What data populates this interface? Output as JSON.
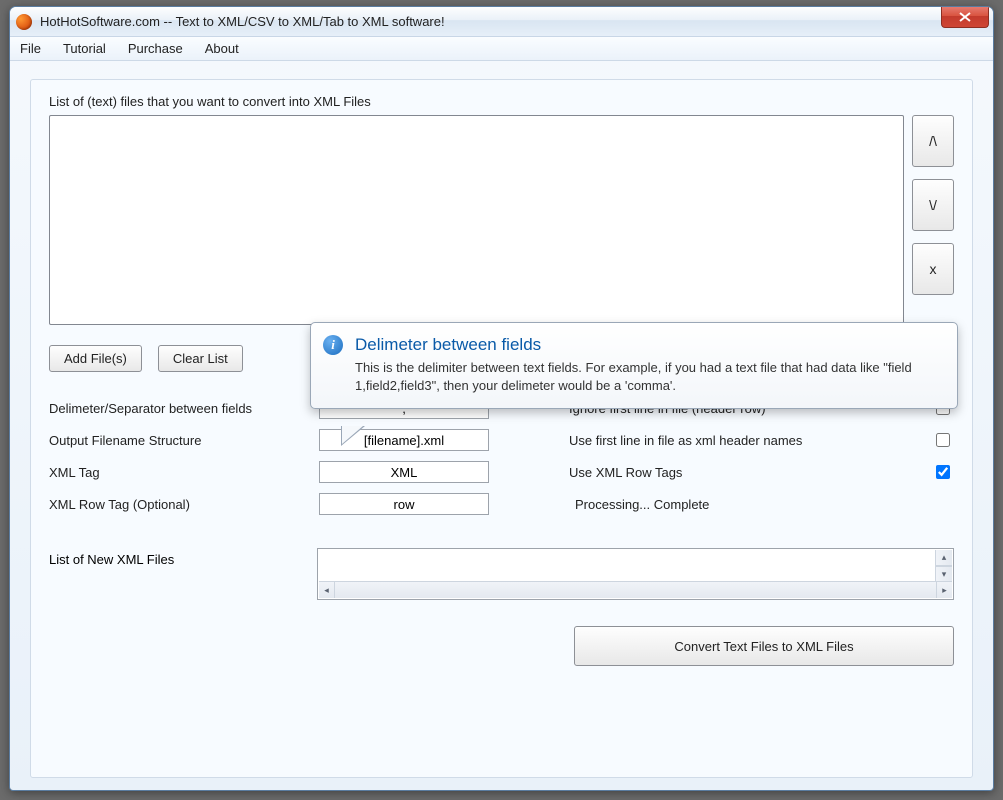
{
  "window": {
    "title": "HotHotSoftware.com -- Text to XML/CSV to XML/Tab to XML software!"
  },
  "menu": {
    "file": "File",
    "tutorial": "Tutorial",
    "purchase": "Purchase",
    "about": "About"
  },
  "labels": {
    "file_list": "List of (text) files that you want to convert into XML Files",
    "output_list": "List of New XML Files"
  },
  "buttons": {
    "add_files": "Add File(s)",
    "clear_list": "Clear List",
    "up": "/\\",
    "down": "\\/",
    "remove": "x",
    "convert": "Convert Text Files to XML Files"
  },
  "fields": {
    "delimiter": {
      "label": "Delimeter/Separator between fields",
      "value": ","
    },
    "output_name": {
      "label": "Output Filename Structure",
      "value": "[filename].xml"
    },
    "xml_tag": {
      "label": "XML Tag",
      "value": "XML"
    },
    "row_tag": {
      "label": "XML Row Tag (Optional)",
      "value": "row"
    }
  },
  "checks": {
    "ignore_first": {
      "label": "Ignore first line in file (header row)",
      "checked": false
    },
    "use_first_header": {
      "label": "Use first line in file as xml header names",
      "checked": false
    },
    "use_row_tags": {
      "label": "Use XML Row Tags",
      "checked": true
    }
  },
  "status": "Processing... Complete",
  "tooltip": {
    "title": "Delimeter between fields",
    "body": "This is the delimiter between text fields. For example, if you had a text file that had data like \"field 1,field2,field3\", then your delimeter would be a 'comma'."
  }
}
